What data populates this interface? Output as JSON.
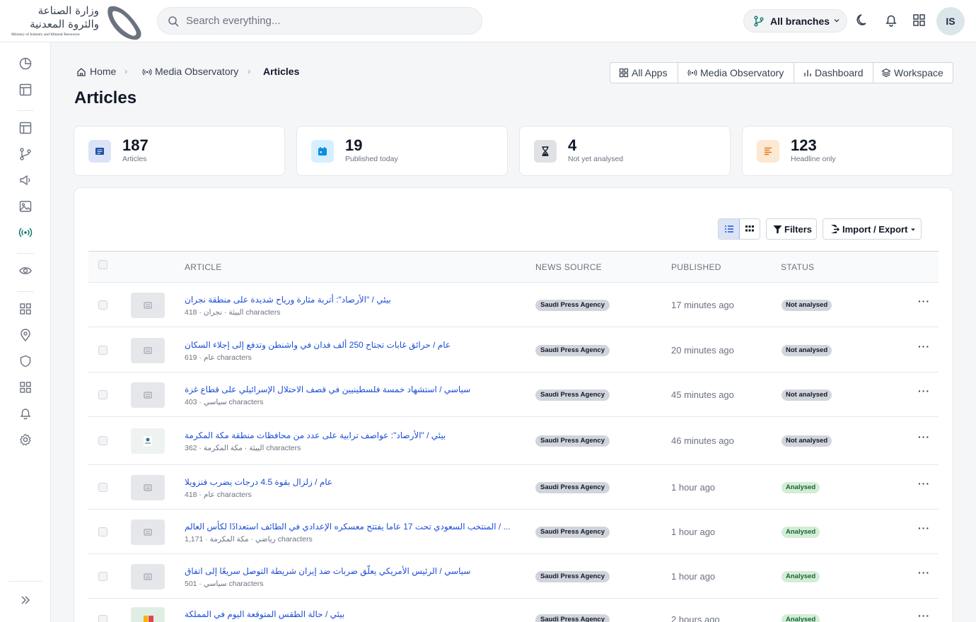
{
  "header": {
    "logo_arabic": "وزارة الصناعة والثروة المعدنية",
    "logo_english": "Ministry of Industry and Mineral Resources",
    "search_placeholder": "Search everything...",
    "branch_label": "All branches",
    "avatar_initials": "IS"
  },
  "breadcrumb": {
    "home": "Home",
    "section": "Media Observatory",
    "current": "Articles"
  },
  "page": {
    "title": "Articles"
  },
  "app_links": [
    "All Apps",
    "Media Observatory",
    "Dashboard",
    "Workspace"
  ],
  "stats": [
    {
      "value": "187",
      "label": "Articles",
      "color": "#dbe4f7",
      "icon": "newspaper-icon"
    },
    {
      "value": "19",
      "label": "Published today",
      "color": "#d6efff",
      "icon": "calendar-icon"
    },
    {
      "value": "4",
      "label": "Not yet analysed",
      "color": "#dfe1e4",
      "icon": "hourglass-icon"
    },
    {
      "value": "123",
      "label": "Headline only",
      "color": "#fde8d2",
      "icon": "text-lines-icon"
    }
  ],
  "toolbar": {
    "filters_label": "Filters",
    "import_export_label": "Import / Export"
  },
  "table": {
    "columns": [
      "ARTICLE",
      "NEWS SOURCE",
      "PUBLISHED",
      "STATUS"
    ],
    "rows": [
      {
        "title": "بيئي / \"الأرصاد\": أتربة مثارة ورياح شديدة على منطقة نجران",
        "meta": "418 · البيئة · نجران characters",
        "source": "Saudi Press Agency",
        "published": "17 minutes ago",
        "status": "Not analysed"
      },
      {
        "title": "عام / حرائق غابات تجتاح 250 ألف فدان في واشنطن وتدفع إلى إجلاء السكان",
        "meta": "619 · عام characters",
        "source": "Saudi Press Agency",
        "published": "20 minutes ago",
        "status": "Not analysed"
      },
      {
        "title": "سياسي / استشهاد خمسة فلسطينيين في قصف الاحتلال الإسرائيلي على قطاع غزة",
        "meta": "403 · سياسي characters",
        "source": "Saudi Press Agency",
        "published": "45 minutes ago",
        "status": "Not analysed"
      },
      {
        "title": "بيئي / \"الأرصاد\": عواصف ترابية على عدد من محافظات منطقة مكة المكرمة",
        "meta": "362 · البيئة · مكة المكرمة characters",
        "source": "Saudi Press Agency",
        "published": "46 minutes ago",
        "status": "Not analysed"
      },
      {
        "title": "عام / زلزال بقوة 4.5 درجات يضرب فنزويلا",
        "meta": "418 · عام characters",
        "source": "Saudi Press Agency",
        "published": "1 hour ago",
        "status": "Analysed"
      },
      {
        "title": "... / المنتخب السعودي تحت 17 عاما يفتتح معسكره الإعدادي في الطائف استعدادًا لكأس العالم",
        "meta": "1,171 · رياضي · مكة المكرمة characters",
        "source": "Saudi Press Agency",
        "published": "1 hour ago",
        "status": "Analysed"
      },
      {
        "title": "سياسي / الرئيس الأمريكي يعلّق ضربات ضد إيران شريطة التوصل سريعًا إلى اتفاق",
        "meta": "501 · سياسي characters",
        "source": "Saudi Press Agency",
        "published": "1 hour ago",
        "status": "Analysed"
      },
      {
        "title": "بيئي / حالة الطقس المتوقعة اليوم في المملكة",
        "meta": "",
        "source": "Saudi Press Agency",
        "published": "2 hours ago",
        "status": "Analysed"
      }
    ]
  },
  "colors": {
    "accent": "#1d4ed8",
    "teal_active": "#0f766e",
    "analysed_bg": "#d4edd6",
    "not_analysed_bg": "#d1d5db"
  }
}
